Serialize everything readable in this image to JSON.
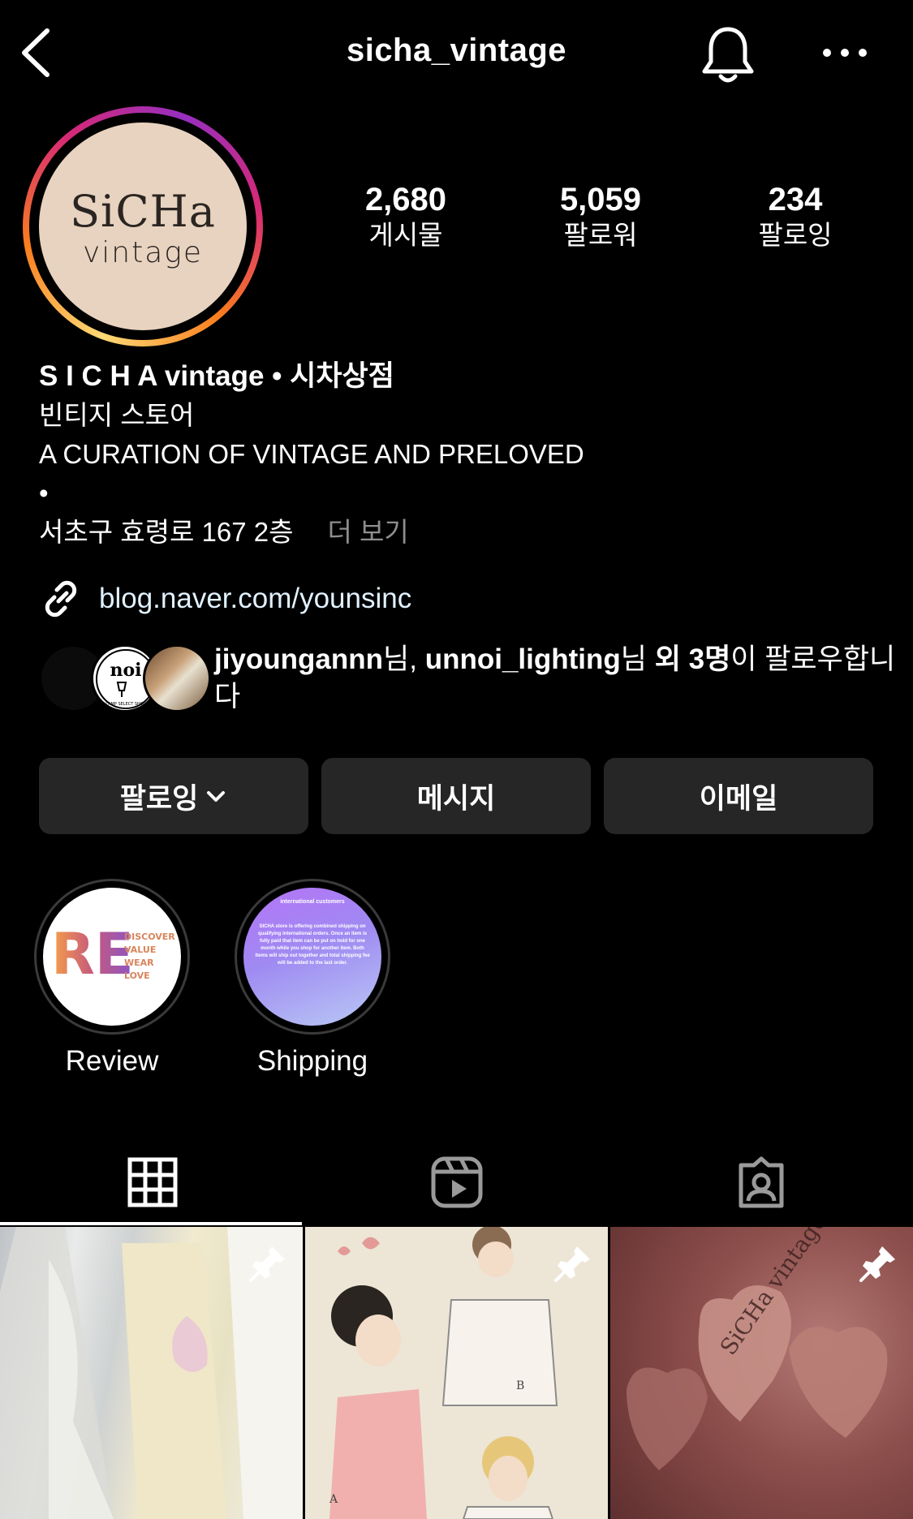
{
  "header": {
    "username": "sicha_vintage",
    "back_icon": "chevron-left-icon",
    "bell_icon": "bell-icon",
    "more_icon": "more-horizontal-icon"
  },
  "avatar": {
    "line1": "SiCHa",
    "line2": "vintage",
    "background_color": "#e8d3c0"
  },
  "stats": [
    {
      "value": "2,680",
      "label": "게시물"
    },
    {
      "value": "5,059",
      "label": "팔로워"
    },
    {
      "value": "234",
      "label": "팔로잉"
    }
  ],
  "bio": {
    "name": "S I C H A vintage • 시차상점",
    "category": "빈티지 스토어",
    "line1": "A CURATION OF VINTAGE AND PRELOVED",
    "line2": "•",
    "line3": "서초구 효령로 167 2층",
    "more": "더 보기",
    "link_icon": "link-icon",
    "link": "blog.naver.com/younsinc"
  },
  "followed_by": {
    "user1": "jiyoungannn",
    "sep1": "님, ",
    "user2": "unnoi_lighting",
    "sep2": "님 ",
    "count": "외 3명",
    "suffix": "이 팔로우합니다",
    "fav2_label": "LAMP SELECT SHOP"
  },
  "buttons": {
    "following": "팔로잉",
    "message": "메시지",
    "email": "이메일"
  },
  "highlights": [
    {
      "label": "Review",
      "cover_big": "RE",
      "cover_words": [
        "DISCOVER",
        "VALUE",
        "WEAR",
        "LOVE"
      ]
    },
    {
      "label": "Shipping",
      "cover_title": "international customers",
      "cover_text": "SICHA store is offering combined shipping on qualifying international orders. Once an item is fully paid that item can be put on hold for one month while you shop for another item. Both items will ship out together and total shipping fee will be added to the last order."
    }
  ],
  "tabs": [
    {
      "icon": "grid-icon",
      "active": true
    },
    {
      "icon": "reels-icon",
      "active": false
    },
    {
      "icon": "tagged-icon",
      "active": false
    }
  ],
  "posts": [
    {
      "pinned": true,
      "subject": "lace vintage clothing"
    },
    {
      "pinned": true,
      "subject": "vintage sewing pattern illustration",
      "marks": [
        "A",
        "B"
      ]
    },
    {
      "pinned": true,
      "subject": "heart-shaped tags",
      "tag_text": "SiCHa vintage"
    }
  ],
  "colors": {
    "background": "#000000",
    "button_bg": "#262626",
    "muted_text": "#8e8e8e",
    "link_text": "#e0f1ff"
  }
}
